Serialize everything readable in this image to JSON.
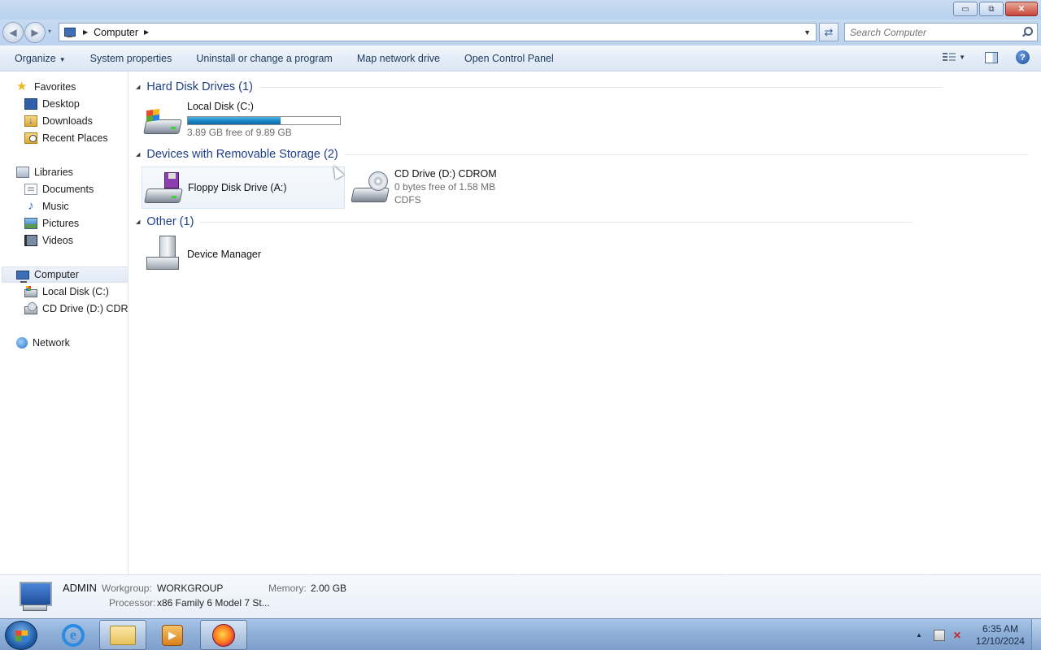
{
  "window": {
    "minimize_symbol": "▭",
    "maximize_symbol": "⧉",
    "close_symbol": "✕"
  },
  "nav": {
    "back_symbol": "◀",
    "forward_symbol": "▶",
    "history_symbol": "▾"
  },
  "address": {
    "breadcrumb": [
      "Computer"
    ],
    "separator": "▶",
    "dropdown_symbol": "▼",
    "refresh_symbol": "⇄"
  },
  "search": {
    "placeholder": "Search Computer"
  },
  "commandbar": {
    "organize": "Organize",
    "caret": "▼",
    "system_properties": "System properties",
    "uninstall": "Uninstall or change a program",
    "map_drive": "Map network drive",
    "control_panel": "Open Control Panel",
    "help": "?"
  },
  "sidebar": {
    "favorites": {
      "label": "Favorites",
      "items": [
        {
          "label": "Desktop",
          "icon": "desktop-icon"
        },
        {
          "label": "Downloads",
          "icon": "downloads-icon"
        },
        {
          "label": "Recent Places",
          "icon": "recent-places-icon"
        }
      ]
    },
    "libraries": {
      "label": "Libraries",
      "items": [
        {
          "label": "Documents",
          "icon": "documents-icon"
        },
        {
          "label": "Music",
          "icon": "music-icon"
        },
        {
          "label": "Pictures",
          "icon": "pictures-icon"
        },
        {
          "label": "Videos",
          "icon": "videos-icon"
        }
      ]
    },
    "computer": {
      "label": "Computer",
      "items": [
        {
          "label": "Local Disk (C:)",
          "icon": "local-disk-icon"
        },
        {
          "label": "CD Drive (D:) CDROM",
          "icon": "cd-drive-icon"
        }
      ]
    },
    "network": {
      "label": "Network"
    }
  },
  "groups": {
    "hard_disks": {
      "title": "Hard Disk Drives (1)",
      "items": [
        {
          "name": "Local Disk (C:)",
          "free_text": "3.89 GB free of 9.89 GB",
          "used_fraction": 0.607
        }
      ]
    },
    "removable": {
      "title": "Devices with Removable Storage (2)",
      "items": [
        {
          "name": "Floppy Disk Drive (A:)"
        },
        {
          "name": "CD Drive (D:) CDROM",
          "free_text": "0 bytes free of 1.58 MB",
          "filesystem": "CDFS"
        }
      ]
    },
    "other": {
      "title": "Other (1)",
      "items": [
        {
          "name": "Device Manager"
        }
      ]
    }
  },
  "details": {
    "name": "ADMIN",
    "workgroup_label": "Workgroup:",
    "workgroup_value": "WORKGROUP",
    "memory_label": "Memory:",
    "memory_value": "2.00 GB",
    "processor_label": "Processor:",
    "processor_value": "x86 Family 6 Model 7 St..."
  },
  "taskbar": {
    "ie_letter": "e",
    "media_symbol": "▶",
    "tray_arrow": "▲",
    "sound_symbol": "✕",
    "time": "6:35 AM",
    "date": "12/10/2024"
  },
  "colors": {
    "accent": "#1e3e8a",
    "progress": "#1a86c4"
  }
}
